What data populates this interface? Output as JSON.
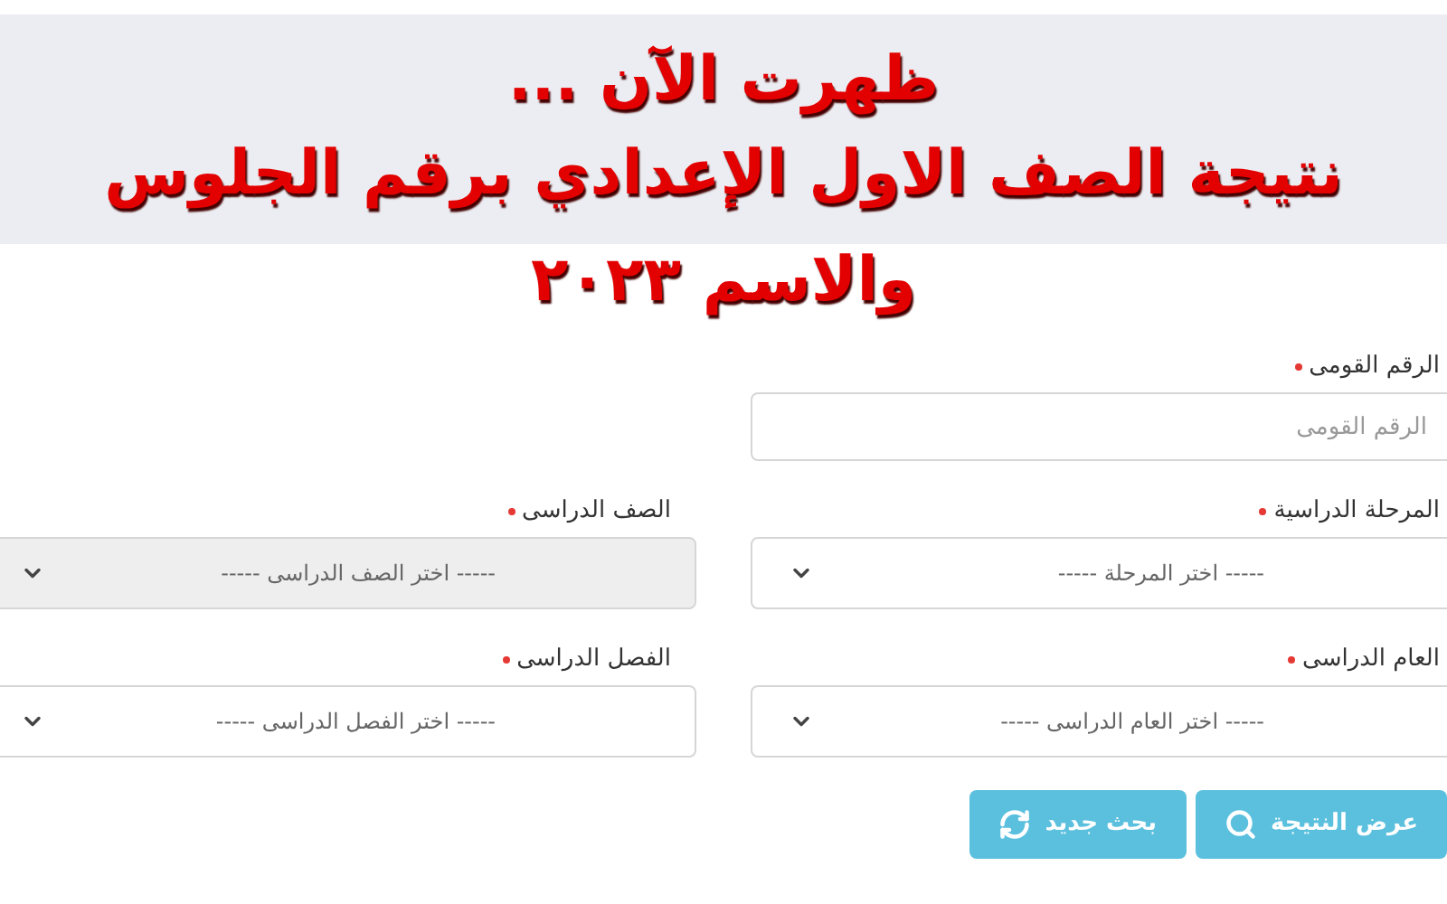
{
  "headline": [
    "ظهرت الآن ...",
    "نتيجة الصف الاول الإعدادي برقم الجلوس",
    "والاسم ٢٠٢٣"
  ],
  "form": {
    "rows": [
      [
        {
          "kind": "text",
          "label": "الرقم القومى",
          "required": true,
          "placeholder": "الرقم القومى",
          "disabled": false
        }
      ],
      [
        {
          "kind": "select",
          "label": "المرحلة الدراسية",
          "required": true,
          "value": "----- اختر المرحلة -----",
          "disabled": false
        },
        {
          "kind": "select",
          "label": "الصف الدراسى",
          "required": true,
          "value": "----- اختر الصف الدراسى -----",
          "disabled": true
        }
      ],
      [
        {
          "kind": "select",
          "label": "العام الدراسى",
          "required": true,
          "value": "----- اختر العام الدراسى -----",
          "disabled": false
        },
        {
          "kind": "select",
          "label": "الفصل الدراسى",
          "required": true,
          "value": "----- اختر الفصل الدراسى -----",
          "disabled": false
        }
      ]
    ],
    "buttons": [
      {
        "kind": "search",
        "label": "عرض النتيجة"
      },
      {
        "kind": "reset",
        "label": "بحث جديد"
      }
    ]
  }
}
